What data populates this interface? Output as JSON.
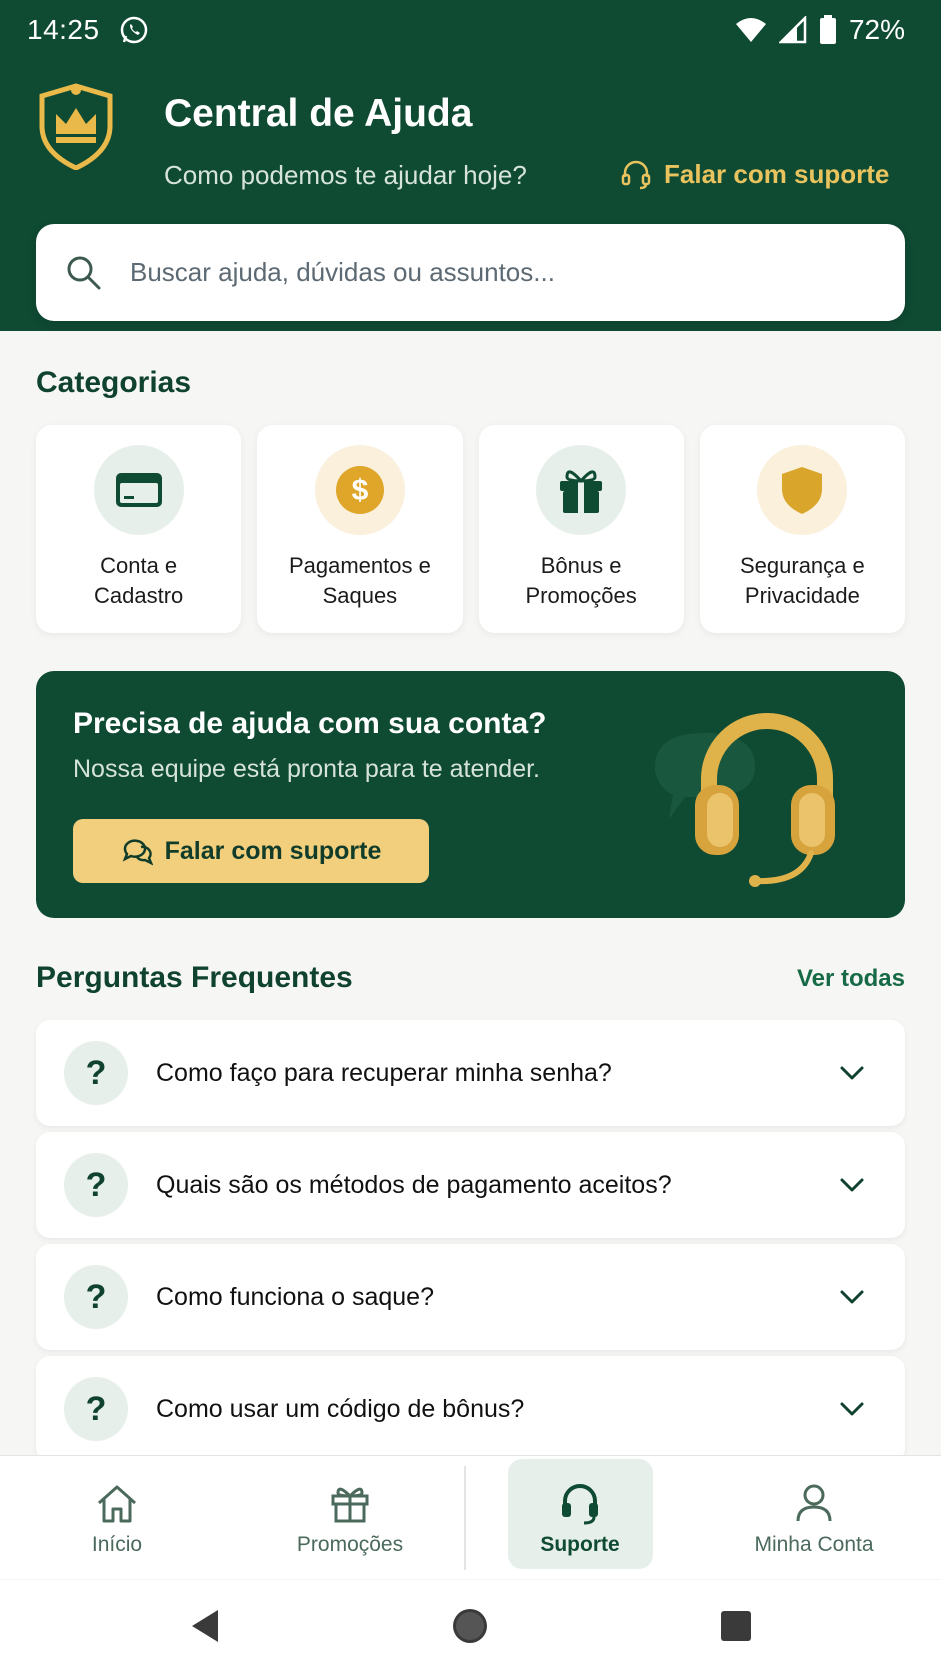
{
  "status_bar": {
    "time": "14:25",
    "battery": "72%"
  },
  "header": {
    "title": "Central de Ajuda",
    "subtitle": "Como podemos te ajudar hoje?",
    "support_link": "Falar com suporte"
  },
  "search": {
    "placeholder": "Buscar ajuda, dúvidas ou assuntos..."
  },
  "categories": {
    "title": "Categorias",
    "items": [
      {
        "label": "Conta e\nCadastro",
        "icon": "card-icon"
      },
      {
        "label": "Pagamentos e\nSaques",
        "icon": "dollar-coin-icon"
      },
      {
        "label": "Bônus e\nPromoções",
        "icon": "gift-icon"
      },
      {
        "label": "Segurança e\nPrivacidade",
        "icon": "shield-icon"
      }
    ]
  },
  "promo": {
    "title": "Precisa de ajuda com sua conta?",
    "subtitle": "Nossa equipe está pronta para te atender.",
    "button": "Falar com suporte"
  },
  "faq": {
    "title": "Perguntas Frequentes",
    "view_all": "Ver todas",
    "items": [
      "Como faço para recuperar minha senha?",
      "Quais são os métodos de pagamento aceitos?",
      "Como funciona o saque?",
      "Como usar um código de bônus?"
    ]
  },
  "bottom_nav": {
    "items": [
      {
        "label": "Início",
        "icon": "home-icon"
      },
      {
        "label": "Promoções",
        "icon": "gift-icon"
      },
      {
        "label": "Suporte",
        "icon": "headset-icon",
        "active": true
      },
      {
        "label": "Minha Conta",
        "icon": "user-icon"
      }
    ]
  },
  "colors": {
    "brand_green": "#0f4a33",
    "gold": "#e9c45e",
    "button_gold": "#f2cf7c"
  }
}
